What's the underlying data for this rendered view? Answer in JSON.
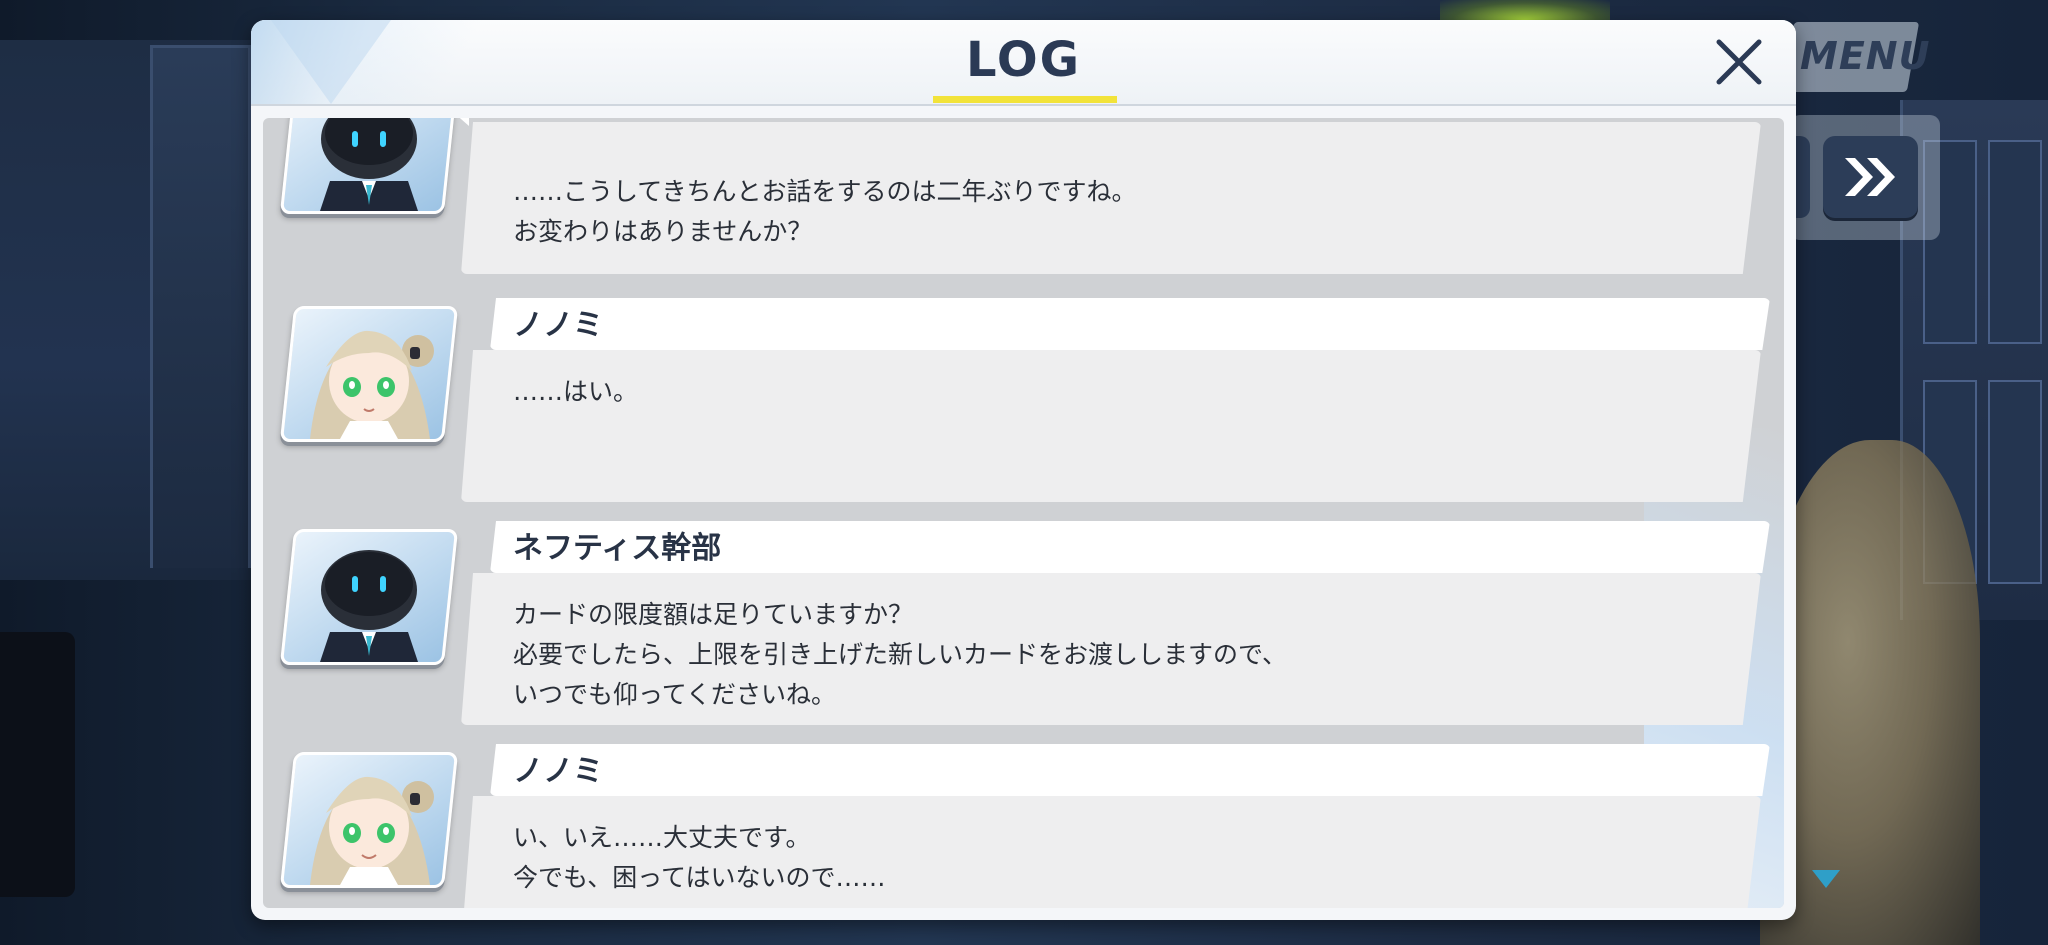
{
  "hud": {
    "menu_label": "MENU",
    "fast_forward_icon": "double-chevron-right"
  },
  "log": {
    "title": "LOG",
    "close_icon": "close-x",
    "entries": [
      {
        "speaker": "",
        "avatar": "robot-executive",
        "lines": [
          "……こうしてきちんとお話をするのは二年ぶりですね。",
          "お変わりはありませんか？"
        ]
      },
      {
        "speaker": "ノノミ",
        "avatar": "nonomi",
        "lines": [
          "……はい。"
        ]
      },
      {
        "speaker": "ネフティス幹部",
        "avatar": "robot-executive",
        "lines": [
          "カードの限度額は足りていますか？",
          "必要でしたら、上限を引き上げた新しいカードをお渡ししますので、",
          "いつでも仰ってくださいね。"
        ]
      },
      {
        "speaker": "ノノミ",
        "avatar": "nonomi",
        "lines": [
          "い、いえ……大丈夫です。",
          "今でも、困ってはいないので……"
        ]
      }
    ]
  },
  "colors": {
    "title": "#2b3a55",
    "underline": "#f2e33a",
    "robot_eye": "#3fd4ff",
    "nonomi_eye": "#3cc46a"
  }
}
